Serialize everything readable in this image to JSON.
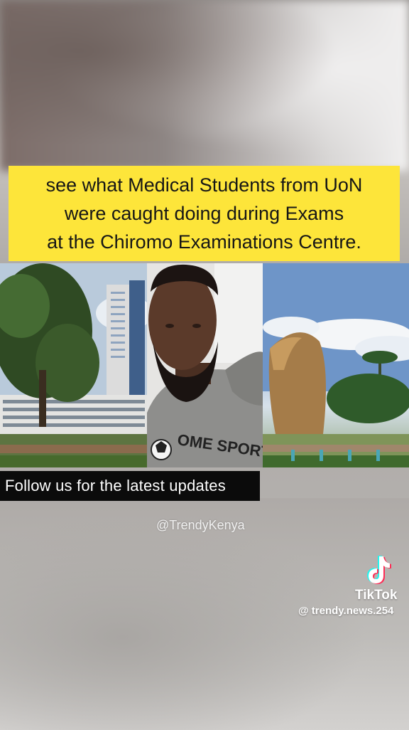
{
  "video": {
    "caption": "see what Medical Students from UoN\nwere caught doing during Exams\nat the Chiromo Examinations Centre.",
    "follow_banner": "Follow us for the latest updates",
    "source_handle": "@TrendyKenya"
  },
  "watermark": {
    "brand": "TikTok",
    "handle": "@ trendy.news.254",
    "icon": "tiktok-logo-icon"
  },
  "colors": {
    "caption_background": "#fde53a",
    "banner_background": "#0b0b0b",
    "text_white": "#ffffff"
  },
  "shirt_print": "OME SPORT"
}
